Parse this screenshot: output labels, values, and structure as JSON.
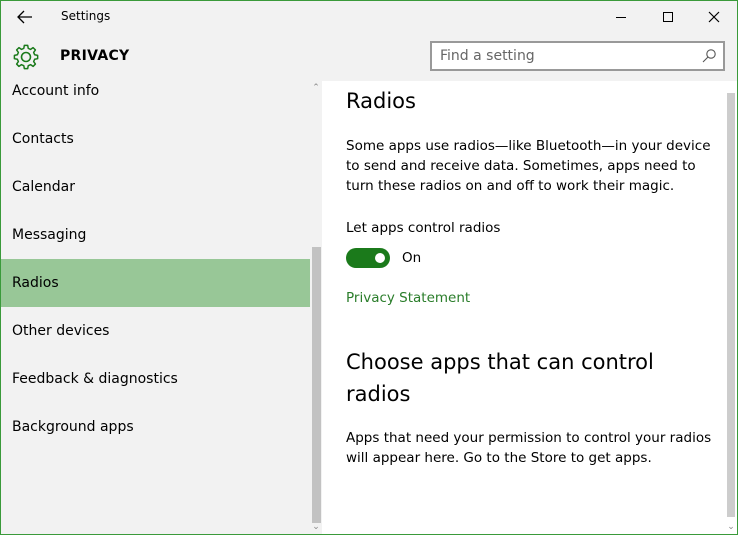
{
  "window": {
    "title": "Settings"
  },
  "header": {
    "title": "PRIVACY",
    "search_placeholder": "Find a setting"
  },
  "sidebar": {
    "items": [
      {
        "label": "Account info",
        "selected": false
      },
      {
        "label": "Contacts",
        "selected": false
      },
      {
        "label": "Calendar",
        "selected": false
      },
      {
        "label": "Messaging",
        "selected": false
      },
      {
        "label": "Radios",
        "selected": true
      },
      {
        "label": "Other devices",
        "selected": false
      },
      {
        "label": "Feedback & diagnostics",
        "selected": false
      },
      {
        "label": "Background apps",
        "selected": false
      }
    ]
  },
  "main": {
    "heading": "Radios",
    "description": "Some apps use radios—like Bluetooth—in your device to send and receive data. Sometimes, apps need to turn these radios on and off to work their magic.",
    "toggle_label": "Let apps control radios",
    "toggle_state": "On",
    "toggle_on": true,
    "privacy_link": "Privacy Statement",
    "section_heading": "Choose apps that can control radios",
    "section_description": "Apps that need your permission to control your radios will appear here. Go to the Store to get apps."
  },
  "colors": {
    "accent": "#1b7a1b",
    "selected_bg": "#98c797",
    "link": "#2a7d2a",
    "window_border": "#3a9a3a"
  },
  "icons": {
    "back": "back-arrow-icon",
    "minimize": "minimize-icon",
    "maximize": "maximize-icon",
    "close": "close-icon",
    "settings": "gear-icon",
    "search": "search-icon"
  }
}
